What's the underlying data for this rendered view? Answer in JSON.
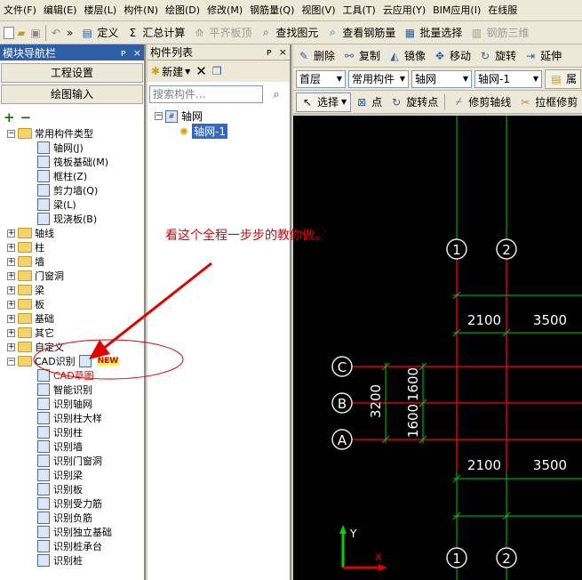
{
  "menu": [
    "文件(F)",
    "编辑(E)",
    "楼层(L)",
    "构件(N)",
    "绘图(D)",
    "修改(M)",
    "钢筋量(Q)",
    "视图(V)",
    "工具(T)",
    "云应用(Y)",
    "BIM应用(I)",
    "在线服"
  ],
  "toolbar": {
    "overflow": "»",
    "define": "定义",
    "summary": "汇总计算",
    "flat_board": "平齐板顶",
    "find": "查找图元",
    "view_rebar": "查看钢筋量",
    "batch_select": "批量选择",
    "rebar_3d": "钢筋三维"
  },
  "nav": {
    "title": "模块导航栏",
    "pin": "ᴘ",
    "close": "×",
    "project_settings": "工程设置",
    "drawing_input": "绘图输入",
    "expand_all": "+",
    "collapse_all": "−",
    "tree": {
      "common": "常用构件类型",
      "common_items": [
        "轴网(J)",
        "筏板基础(M)",
        "框柱(Z)",
        "剪力墙(Q)",
        "梁(L)",
        "现浇板(B)"
      ],
      "groups": [
        "轴线",
        "柱",
        "墙",
        "门窗洞",
        "梁",
        "板",
        "基础",
        "其它",
        "自定义"
      ],
      "cad": "CAD识别",
      "new_badge": "NEW",
      "cad_items": [
        "CAD草图",
        "智能识别",
        "识别轴网",
        "识别柱大样",
        "识别柱",
        "识别墙",
        "识别门窗洞",
        "识别梁",
        "识别板",
        "识别受力筋",
        "识别负筋",
        "识别独立基础",
        "识别桩承台",
        "识别桩"
      ]
    }
  },
  "comp": {
    "title": "构件列表",
    "new": "新建",
    "search_placeholder": "搜索构件...",
    "root": "轴网",
    "item": "轴网-1"
  },
  "draw_toolbar": {
    "delete": "删除",
    "copy": "复制",
    "mirror": "镜像",
    "move": "移动",
    "rotate": "旋转",
    "extend": "延伸"
  },
  "selector": {
    "floor": "首层",
    "type": "常用构件",
    "category": "轴网",
    "component": "轴网-1",
    "more": "属"
  },
  "draw_tools": {
    "select": "选择",
    "point": "点",
    "rotate_point": "旋转点",
    "trim_axis": "修剪轴线",
    "pull_trim": "拉框修剪"
  },
  "cad": {
    "col_labels": [
      "1",
      "2"
    ],
    "row_labels": [
      "C",
      "B",
      "A"
    ],
    "top_dims": [
      "2100",
      "3500"
    ],
    "bottom_dims": [
      "2100",
      "3500"
    ],
    "left_total": "3200",
    "left_parts": [
      "1600",
      "1600"
    ],
    "axis_y": "Y",
    "axis_x": "X"
  },
  "annotation": {
    "text": "看这个全程一步步的教你做。"
  },
  "colors": {
    "accent": "#2f5fa8",
    "annotation": "#e00000",
    "grid": "#00c800",
    "canvas": "#000000"
  }
}
